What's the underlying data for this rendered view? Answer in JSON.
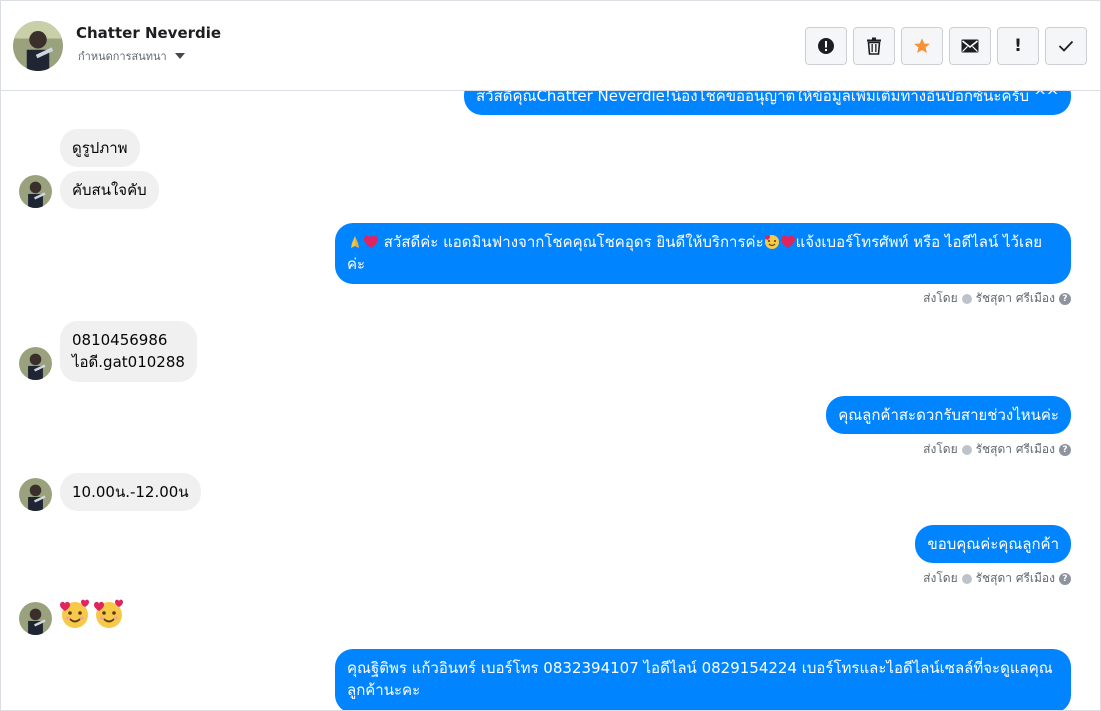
{
  "header": {
    "name": "Chatter Neverdie",
    "subtitle": "กำหนดการสนทนา"
  },
  "actions": {
    "exclamation_label": "!"
  },
  "messages": {
    "top_partial": "สวัสดีคุณChatter Neverdie!น้องโชคขออนุญาตให้ข้อมูลเพิ่มเติมทางอินบ๊อกซ์นะครับ ^^",
    "in_1": "ดูรูปภาพ",
    "in_2": "คับสนใจคับ",
    "out_1_a": "สวัสดีค่ะ แอดมินฟางจากโชคคุณโชคอุดร ยินดีให้บริการค่ะ",
    "out_1_b": "แจ้งเบอร์โทรศัพท์ หรือ ไอดีไลน์  ไว้เลยค่ะ",
    "in_3_line1": "0810456986",
    "in_3_line2": "ไอดี.gat010288",
    "out_2": "คุณลูกค้าสะดวกรับสายช่วงไหนค่ะ",
    "in_4": "10.00น.-12.00น",
    "out_3": "ขอบคุณค่ะคุณลูกค้า",
    "out_4": "คุณฐิติพร แก้วอินทร์       เบอร์โทร 0832394107  ไอดีไลน์ 0829154224   เบอร์โทรและไอดีไลน์เซลล์ที่จะดูแลคุณลูกค้านะคะ"
  },
  "sent_by": {
    "prefix": "ส่งโดย",
    "agent": "รัชสุดา ศรีเมือง",
    "help": "?"
  },
  "colors": {
    "accent": "#0084ff",
    "incoming_bg": "#f0f0f0",
    "star": "#f7923a"
  },
  "icons": [
    "alert-icon",
    "trash-icon",
    "star-icon",
    "mail-icon",
    "exclamation-icon",
    "check-icon",
    "chevron-down-icon",
    "praying-hands-icon",
    "heart-icon",
    "smiling-hearts-icon"
  ]
}
